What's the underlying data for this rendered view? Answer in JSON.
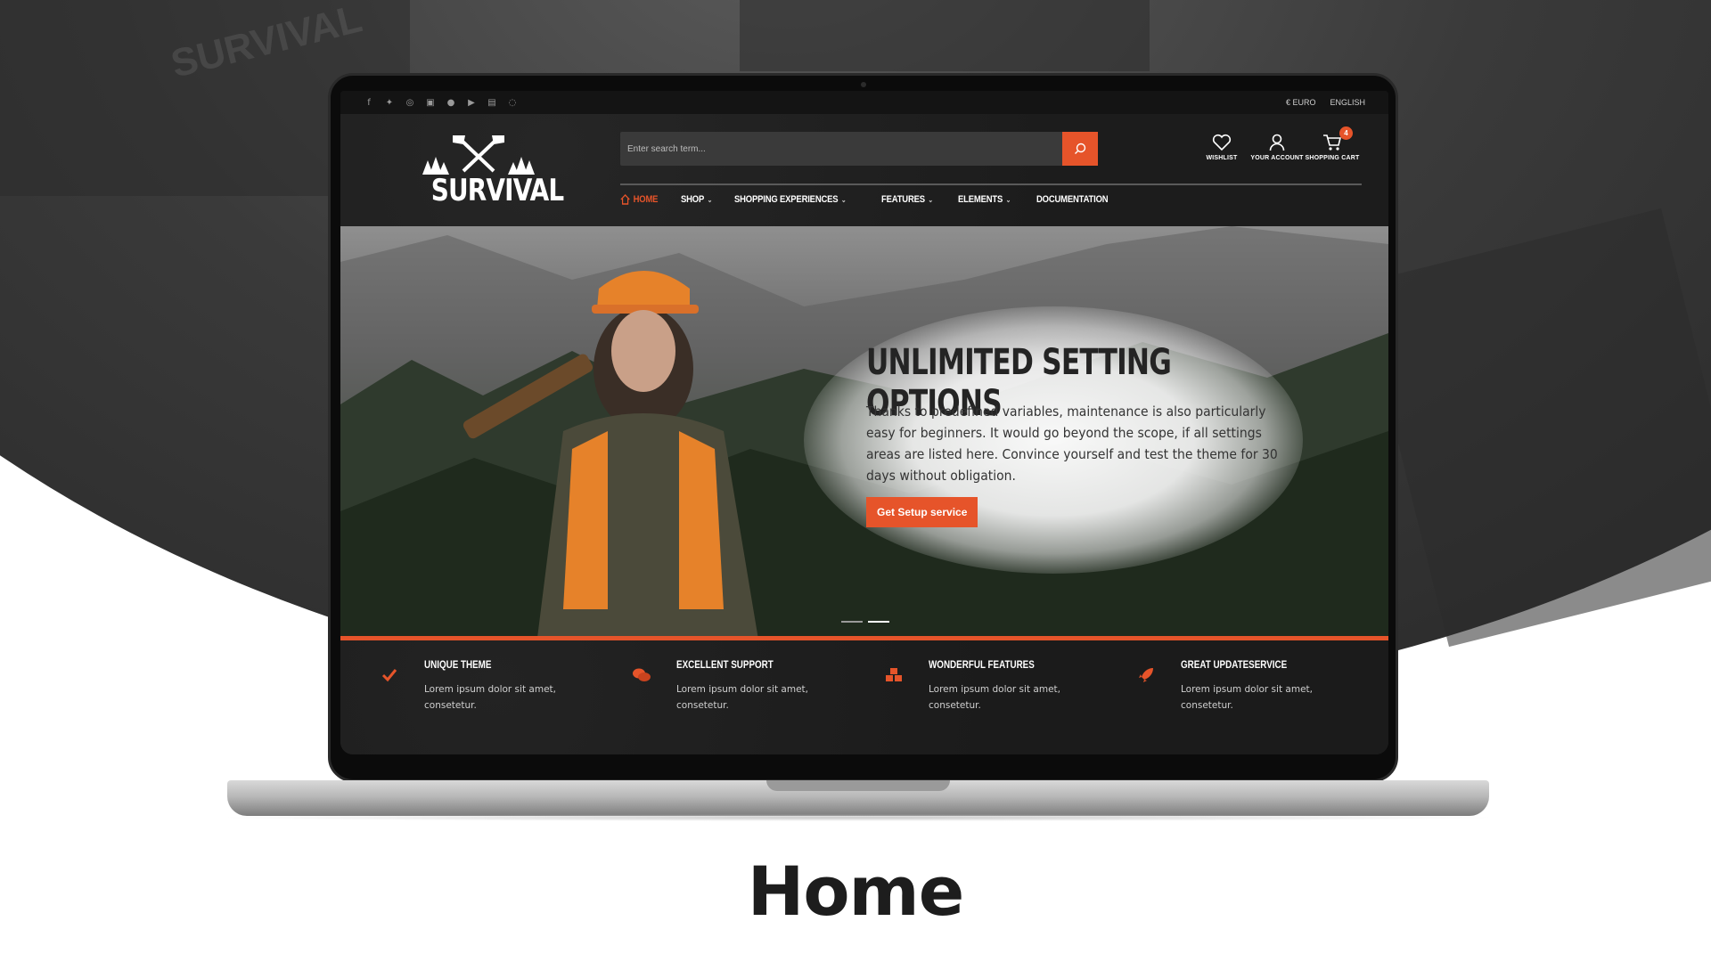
{
  "social_icons": [
    "facebook-icon",
    "twitter-icon",
    "instagram-icon",
    "youtube-icon",
    "apple-icon",
    "google-play-icon",
    "twitch-icon",
    "whatsapp-icon"
  ],
  "utility": {
    "currency": "€ EURO",
    "language": "ENGLISH"
  },
  "logo": {
    "text": "SURVIVAL"
  },
  "search": {
    "placeholder": "Enter search term..."
  },
  "header_actions": [
    {
      "label": "WISHLIST",
      "icon": "heart-icon"
    },
    {
      "label": "YOUR ACCOUNT",
      "icon": "user-icon"
    },
    {
      "label": "SHOPPING CART",
      "icon": "cart-icon",
      "badge": "4"
    }
  ],
  "nav": [
    {
      "label": "HOME",
      "active": true,
      "dropdown": false
    },
    {
      "label": "SHOP",
      "dropdown": true
    },
    {
      "label": "SHOPPING EXPERIENCES",
      "dropdown": true
    },
    {
      "label": "FEATURES",
      "dropdown": true
    },
    {
      "label": "ELEMENTS",
      "dropdown": true
    },
    {
      "label": "DOCUMENTATION",
      "dropdown": false
    }
  ],
  "hero": {
    "title": "UNLIMITED SETTING OPTIONS",
    "text": "Thanks to predefined variables, maintenance is also particularly easy for beginners. It would go beyond the scope, if all settings areas are listed here. Convince yourself and test the theme for 30 days without obligation.",
    "button": "Get Setup service",
    "slides": 2,
    "active_slide": 2
  },
  "features": [
    {
      "title": "UNIQUE THEME",
      "text": "Lorem ipsum dolor sit amet, consetetur.",
      "icon": "check-icon"
    },
    {
      "title": "EXCELLENT SUPPORT",
      "text": "Lorem ipsum dolor sit amet, consetetur.",
      "icon": "chat-icon"
    },
    {
      "title": "WONDERFUL FEATURES",
      "text": "Lorem ipsum dolor sit amet, consetetur.",
      "icon": "cubes-icon"
    },
    {
      "title": "GREAT UPDATESERVICE",
      "text": "Lorem ipsum dolor sit amet, consetetur.",
      "icon": "rocket-icon"
    }
  ],
  "caption": "Home",
  "colors": {
    "accent": "#e6542a",
    "dark": "#1b1b1b",
    "caption": "#1d1d1d"
  }
}
